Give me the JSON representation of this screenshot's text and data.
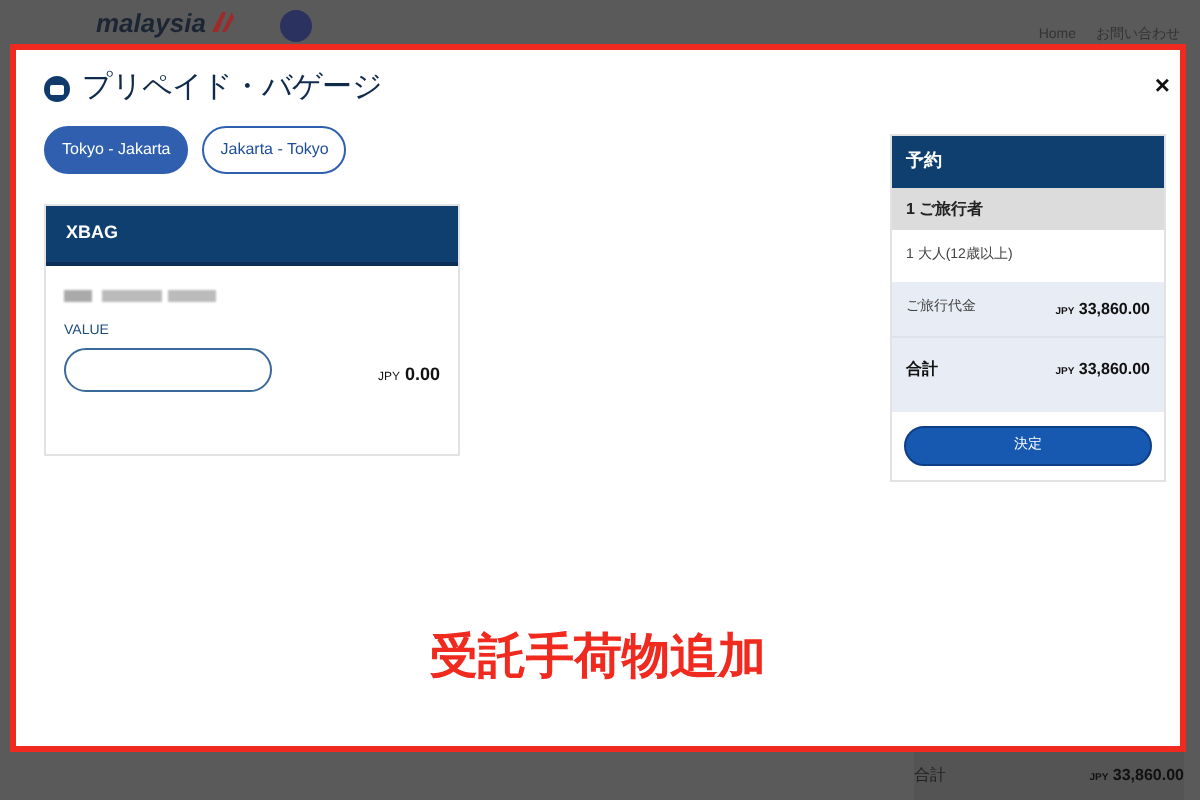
{
  "background_page": {
    "logo": "malaysia",
    "nav": [
      {
        "label": "Home"
      },
      {
        "label": "お問い合わせ"
      }
    ],
    "total": {
      "label": "合計",
      "currency": "JPY",
      "amount": "33,860.00"
    }
  },
  "modal": {
    "title": "プリペイド・バゲージ",
    "close": "×",
    "tabs": [
      {
        "label": "Tokyo - Jakarta",
        "selected": true
      },
      {
        "label": "Jakarta - Tokyo",
        "selected": false
      }
    ],
    "bag_card": {
      "title": "XBAG",
      "field_label": "VALUE",
      "currency": "JPY",
      "amount": "0.00"
    },
    "booking": {
      "title": "予約",
      "travelers_heading": "1 ご旅行者",
      "traveler": "1 大人(12歳以上)",
      "rows": [
        {
          "label": "ご旅行代金",
          "currency": "JPY",
          "amount": "33,860.00",
          "kind": "subtotal"
        },
        {
          "label": "合計",
          "currency": "JPY",
          "amount": "33,860.00",
          "kind": "total"
        }
      ],
      "button": "決定"
    }
  },
  "annotation": "受託手荷物追加"
}
